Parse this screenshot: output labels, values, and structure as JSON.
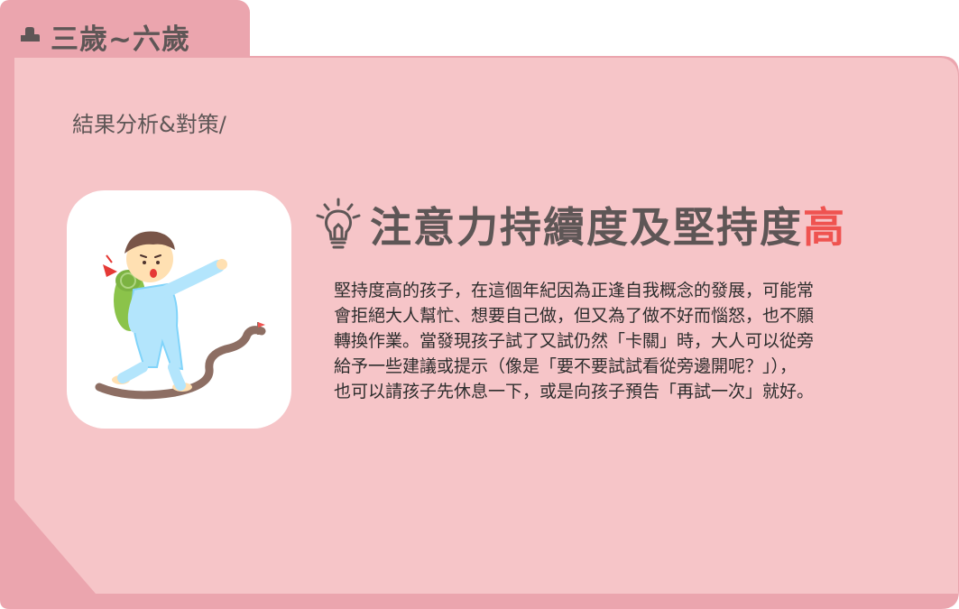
{
  "tab": {
    "icon": "rock-icon",
    "label": "三歲~六歲"
  },
  "subtitle": "結果分析&對策/",
  "illustration": {
    "icon": "toddler-hiking-pointing-illustration"
  },
  "heading": {
    "icon": "lightbulb-icon",
    "main": "注意力持續度及堅持度",
    "highlight": "高"
  },
  "paragraph": {
    "lines": [
      "堅持度高的孩子，在這個年紀因為正逢自我概念的發展，可能常",
      "會拒絕大人幫忙、想要自己做，但又為了做不好而惱怒，也不願",
      "轉換作業。當發現孩子試了又試仍然「卡關」時，大人可以從旁",
      "給予一些建議或提示（像是「要不要試試看從旁邊開呢？」），",
      "也可以請孩子先休息一下，或是向孩子預告「再試一次」就好。"
    ]
  },
  "colors": {
    "card": "#f6c5c8",
    "tab": "#eba5ae",
    "text": "#5e5656",
    "highlight": "#ef5350"
  }
}
